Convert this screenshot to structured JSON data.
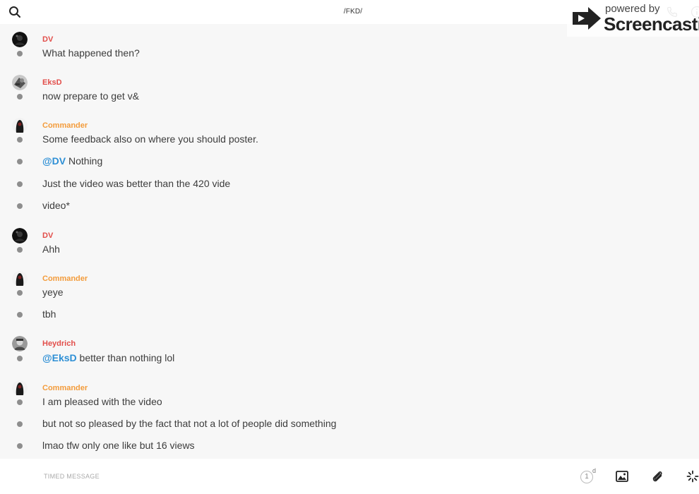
{
  "header": {
    "title": "/FKD/",
    "search_icon": "search-icon",
    "call_icon": "phone-icon",
    "info_icon": "info-icon"
  },
  "watermark": {
    "line1": "powered by",
    "line2": "Screencastify"
  },
  "colors": {
    "author_red": "#e24e4a",
    "author_orange": "#f39c3c",
    "mention_blue": "#2d8fd5",
    "bullet_gray": "#8e8e8e"
  },
  "messages": [
    {
      "author": "DV",
      "author_color": "red",
      "texts": [
        "What happened then?"
      ]
    },
    {
      "author": "EksD",
      "author_color": "red",
      "texts": [
        "now prepare to get v&"
      ]
    },
    {
      "author": "Commander",
      "author_color": "orange",
      "texts": [
        "Some feedback also on where you should poster.",
        {
          "mention": "@DV",
          "rest": " Nothing"
        },
        "Just the video was better than the 420 vide",
        "video*"
      ]
    },
    {
      "author": "DV",
      "author_color": "red",
      "texts": [
        "Ahh"
      ]
    },
    {
      "author": "Commander",
      "author_color": "orange",
      "texts": [
        "yeye",
        "tbh"
      ]
    },
    {
      "author": "Heydrich",
      "author_color": "red",
      "texts": [
        {
          "mention": "@EksD",
          "rest": " better than nothing lol"
        }
      ]
    },
    {
      "author": "Commander",
      "author_color": "orange",
      "texts": [
        "I am pleased with the video",
        "but not so pleased by the fact that not a lot of people did something",
        "lmao tfw only one like but 16 views"
      ]
    }
  ],
  "composer": {
    "placeholder": "TIMED MESSAGE",
    "timer_value": "1",
    "timer_unit": "d",
    "image_icon": "image-icon",
    "attach_icon": "paperclip-icon",
    "more_icon": "spinner-icon"
  }
}
